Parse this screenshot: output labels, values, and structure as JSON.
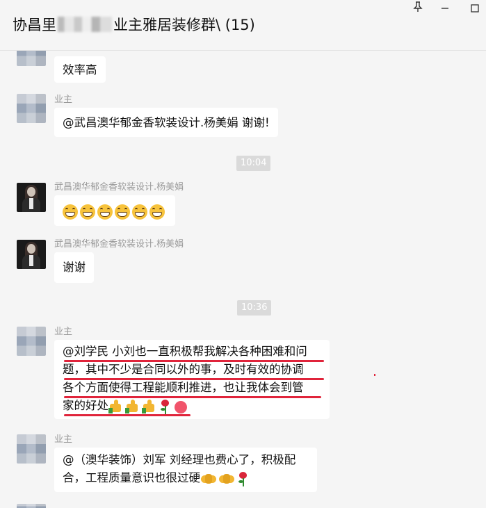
{
  "window": {
    "title_prefix": "协昌里",
    "title_suffix": "业主雅居装修群\\ (15)",
    "pin_icon": "pin-icon",
    "maximize_icon": "maximize-icon"
  },
  "messages": [
    {
      "sender": "",
      "avatar": "pixelated",
      "text": "效率高"
    },
    {
      "sender": "业主",
      "avatar": "pixelated",
      "text": "@武昌澳华郁金香软装设计.杨美娟 谢谢!"
    },
    {
      "sender": "武昌澳华郁金香软装设计.杨美娟",
      "avatar": "photo",
      "emoji": "grinning-face-x6"
    },
    {
      "sender": "武昌澳华郁金香软装设计.杨美娟",
      "avatar": "photo",
      "text": "谢谢"
    },
    {
      "sender": "业主",
      "avatar": "pixelated",
      "lines": [
        "@刘学民 小刘也一直积极帮我解决各种困难和问",
        "题，其中不少是合同以外的事，及时有效的协调",
        "各个方面使得工程能顺利推进，也让我体会到管",
        "家的好处"
      ],
      "trailing_emoji": [
        "thumbs-up",
        "thumbs-up",
        "thumbs-up",
        "rose",
        "heart"
      ]
    },
    {
      "sender": "业主",
      "avatar": "pixelated",
      "lines": [
        "@（澳华装饰）刘军 刘经理也费心了，积极配",
        "合，工程质量意识也很过硬"
      ],
      "trailing_emoji": [
        "handshake",
        "handshake",
        "rose"
      ]
    }
  ],
  "timestamps": [
    "10:04",
    "10:36"
  ]
}
